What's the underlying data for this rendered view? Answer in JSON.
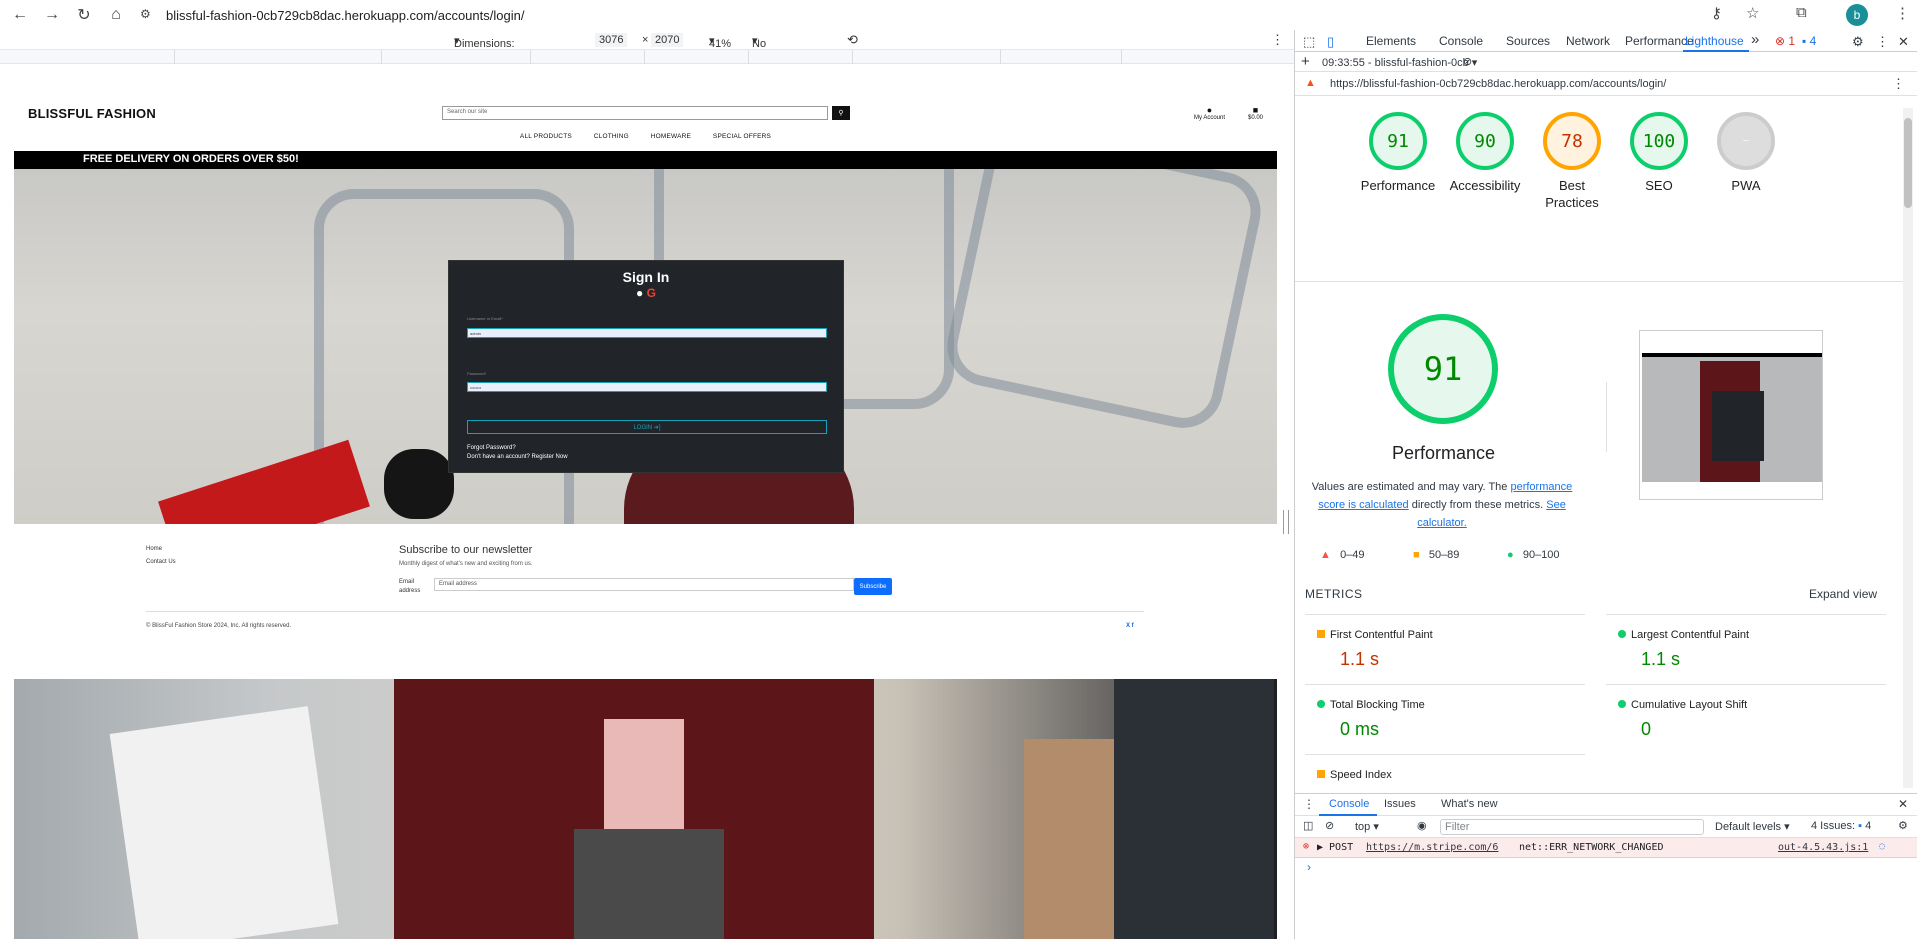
{
  "browser": {
    "url": "blissful-fashion-0cb729cb8dac.herokuapp.com/accounts/login/",
    "profile_initial": "b"
  },
  "device_toolbar": {
    "dimensions_label": "Dimensions: Responsive",
    "width": "3076",
    "times": "×",
    "height": "2070",
    "zoom": "41%",
    "throttling": "No throttling"
  },
  "site": {
    "logo": "BLISSFUL FASHION",
    "search_placeholder": "Search our site",
    "my_account": "My Account",
    "cart_total": "$0.00",
    "nav": [
      "ALL PRODUCTS",
      "CLOTHING",
      "HOMEWARE",
      "SPECIAL OFFERS"
    ],
    "promo": "FREE DELIVERY ON ORDERS OVER $50!",
    "signin": {
      "title": "Sign In",
      "username_label": "Username or Email*",
      "username_value": "admin",
      "password_label": "Password*",
      "password_value": "••••••••",
      "login_button": "LOGIN ➜]",
      "forgot": "Forgot Password?",
      "register": "Don't have an account? Register Now"
    },
    "footer": {
      "links": [
        "Home",
        "Contact Us"
      ],
      "newsletter_title": "Subscribe to our newsletter",
      "newsletter_desc": "Monthly digest of what's new and exciting from us.",
      "email_label": "Email address",
      "email_placeholder": "Email address",
      "subscribe_button": "Subscribe",
      "copyright": "© BlissFul Fashion Store 2024, Inc. All rights reserved.",
      "social": "X f"
    }
  },
  "devtools": {
    "tabs": [
      "Elements",
      "Console",
      "Sources",
      "Network",
      "Performance",
      "Lighthouse"
    ],
    "more": "»",
    "error_count": "1",
    "issue_count": "4",
    "lighthouse_report": "09:33:55 - blissful-fashion-0cb ▾",
    "lighthouse_url": "https://blissful-fashion-0cb729cb8dac.herokuapp.com/accounts/login/",
    "scores": [
      {
        "label": "Performance",
        "value": "91"
      },
      {
        "label": "Accessibility",
        "value": "90"
      },
      {
        "label": "Best Practices",
        "value": "78"
      },
      {
        "label": "SEO",
        "value": "100"
      },
      {
        "label": "PWA",
        "value": "PWA"
      }
    ],
    "big_score": "91",
    "perf_title": "Performance",
    "perf_desc_1": "Values are estimated and may vary. The ",
    "perf_desc_link1": "performance score is calculated",
    "perf_desc_2": " directly from these metrics. ",
    "perf_desc_link2": "See calculator.",
    "legend": [
      "0–49",
      "50–89",
      "90–100"
    ],
    "metrics_title": "METRICS",
    "expand_view": "Expand view",
    "metrics": [
      {
        "name": "First Contentful Paint",
        "value": "1.1 s"
      },
      {
        "name": "Largest Contentful Paint",
        "value": "1.1 s"
      },
      {
        "name": "Total Blocking Time",
        "value": "0 ms"
      },
      {
        "name": "Cumulative Layout Shift",
        "value": "0"
      },
      {
        "name": "Speed Index",
        "value": ""
      }
    ],
    "drawer_tabs": [
      "Console",
      "Issues",
      "What's new"
    ],
    "context": "top",
    "filter_placeholder": "Filter",
    "levels": "Default levels",
    "issues_label": "4 Issues:",
    "issues_count": "4",
    "error_line": {
      "method": "▶ POST",
      "url": "https://m.stripe.com/6",
      "message": "net::ERR_NETWORK_CHANGED",
      "source": "out-4.5.43.js:1"
    },
    "prompt": "›"
  },
  "colors": {
    "pass": "#0cce6b",
    "average": "#ffa400",
    "fail": "#ff4e42",
    "accent": "#1a73e8"
  }
}
